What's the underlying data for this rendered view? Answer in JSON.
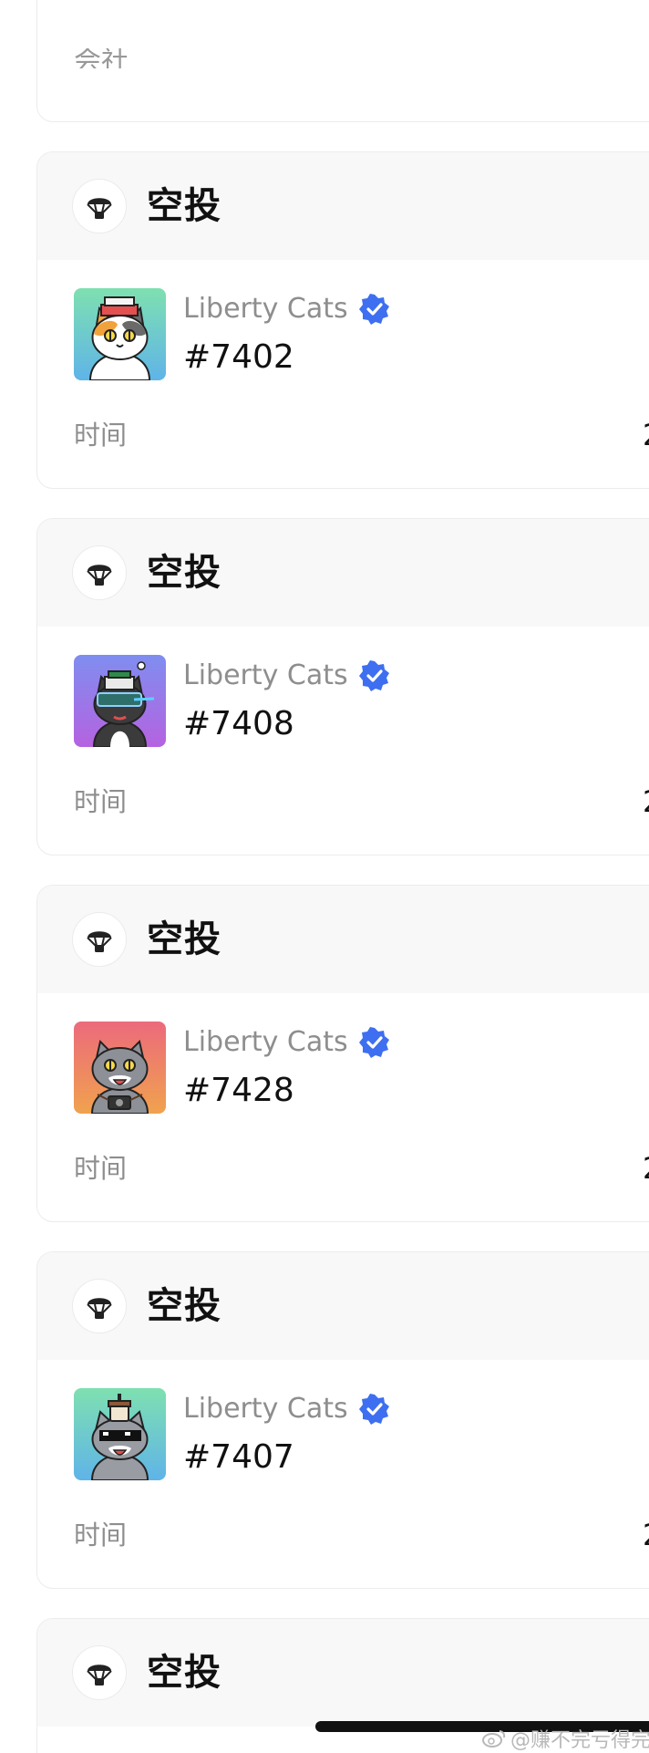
{
  "partial_card": {
    "text": "会社"
  },
  "cards": [
    {
      "title": "空投",
      "icon": "parachute-icon",
      "collection": "Liberty Cats",
      "verified": true,
      "token_id": "#7402",
      "time_label": "时间",
      "time_value": "2",
      "thumb_gradient": [
        "#7ee0b0",
        "#5fb4e8"
      ],
      "cat_fur": "#ffffff",
      "cat_patch": "#f2a23c"
    },
    {
      "title": "空投",
      "icon": "parachute-icon",
      "collection": "Liberty Cats",
      "verified": true,
      "token_id": "#7408",
      "time_label": "时间",
      "time_value": "2",
      "thumb_gradient": [
        "#7f8ef0",
        "#b562e0"
      ],
      "cat_fur": "#3b3b3b",
      "cat_patch": "#ffffff"
    },
    {
      "title": "空投",
      "icon": "parachute-icon",
      "collection": "Liberty Cats",
      "verified": true,
      "token_id": "#7428",
      "time_label": "时间",
      "time_value": "2",
      "thumb_gradient": [
        "#ec6a7c",
        "#f0a24e"
      ],
      "cat_fur": "#8e9097",
      "cat_patch": "#ffffff"
    },
    {
      "title": "空投",
      "icon": "parachute-icon",
      "collection": "Liberty Cats",
      "verified": true,
      "token_id": "#7407",
      "time_label": "时间",
      "time_value": "2",
      "thumb_gradient": [
        "#7ee0b0",
        "#5fb4e8"
      ],
      "cat_fur": "#9a9ca3",
      "cat_patch": "#ffffff"
    }
  ],
  "last_card": {
    "title": "空投",
    "icon": "parachute-icon"
  },
  "watermark": {
    "text": "@赚不完亏得完R"
  },
  "colors": {
    "verified_blue": "#3e6ff0",
    "header_bg": "#f8f8f8",
    "muted_text": "#8e8e8e"
  }
}
